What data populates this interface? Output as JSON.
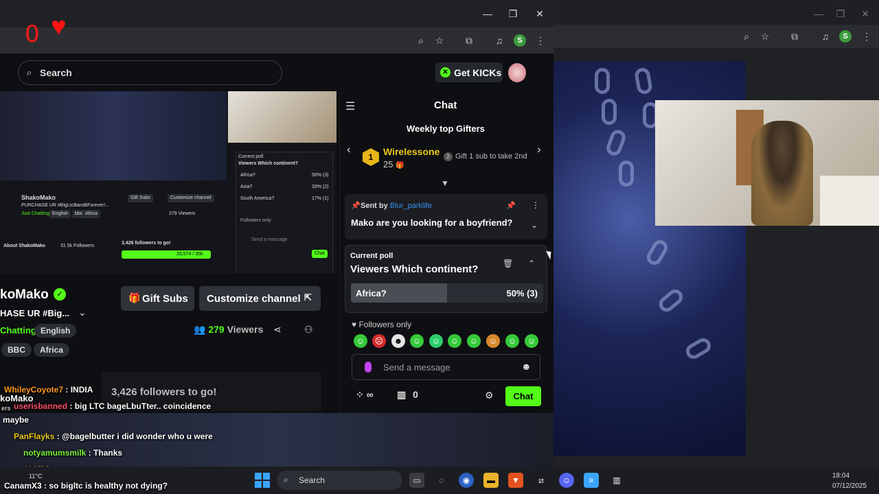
{
  "overlay_counter": "0",
  "browser": {
    "toolbar_icons": [
      "zoom-icon",
      "star-icon",
      "extension-icon",
      "media-icon",
      "profile-icon",
      "menu-icon"
    ],
    "profile_letter": "S"
  },
  "header": {
    "search_placeholder": "Search",
    "get_kicks": "Get KICKs"
  },
  "channel": {
    "name": "koMako",
    "title": "HASE UR #Big...",
    "category": "Chatting",
    "language": "English",
    "tags": [
      "BBC",
      "Africa"
    ],
    "gift_subs": "Gift Subs",
    "customize": "Customize channel",
    "viewer_count": "279",
    "viewers_label": "Viewers",
    "followers_goal": "3,426 followers to go!"
  },
  "mini_stream": {
    "channel": "ShakoMako",
    "purchase": "PURCHASE UR #BigLtcBanditForever!...",
    "category": "Just Chatting",
    "tags": [
      "English",
      "bbc",
      "Africa"
    ],
    "about": "About ShakoMako",
    "followers": "31.5k Followers",
    "viewers": "279 Viewers",
    "gift_subs": "Gift Subs",
    "customize": "Customize channel",
    "goal": "3,426 followers to go!",
    "goal_count": "33,574 / 35k",
    "poll_label": "Current poll",
    "poll_question": "Viewers Which continent?",
    "poll_options": [
      {
        "label": "Africa?",
        "value": "50% (3)"
      },
      {
        "label": "Asia?",
        "value": "33% (2)"
      },
      {
        "label": "South America?",
        "value": "17% (1)"
      }
    ],
    "followers_only": "Followers only",
    "send_placeholder": "Send a message",
    "chat": "Chat"
  },
  "chat": {
    "title": "Chat",
    "gifters_title": "Weekly top Gifters",
    "top_gifter": {
      "rank": "1",
      "name": "Wirelessone",
      "count": "25"
    },
    "gift_tip": "Gift 1 sub to take 2nd",
    "pinned": {
      "sent_by": "Sent by",
      "user": "Blur_parklife",
      "message": "Mako are you looking for a boyfriend?"
    },
    "poll": {
      "label": "Current poll",
      "question": "Viewers Which continent?",
      "option": "Africa?",
      "result": "50% (3)",
      "percent": 50
    },
    "followers_only": "Followers only",
    "placeholder": "Send a message",
    "infinity": "∞",
    "gift_count": "0",
    "send": "Chat"
  },
  "overlay_chat": [
    {
      "user": "WhileyCoyote7",
      "color": "#ff9a1f",
      "text": ": INDIA"
    },
    {
      "user": "userisbanned",
      "color": "#ff4f6a",
      "text": ": big LTC bageLbuTter.. coincidence"
    },
    {
      "user": "",
      "color": "#ffffff",
      "text": "maybe"
    },
    {
      "user": "PanFlayks",
      "color": "#e9c81a",
      "text": ": @bagelbutter i did wonder who u were"
    },
    {
      "user": "notyamumsmilk",
      "color": "#7ef33a",
      "text": ": Thanks"
    },
    {
      "user": "1337hiumx",
      "color": "#e9c81a",
      "text": ":"
    },
    {
      "user": "CanamX3",
      "color": "#ffffff",
      "text": ": so bigltc is healthy not dying?"
    }
  ],
  "overlay_fragments": {
    "name": "koMako",
    "ers": "ers"
  },
  "taskbar": {
    "search": "Search",
    "time": "18:04",
    "date": "07/12/2025",
    "weather": "11°C"
  },
  "colors": {
    "kick_green": "#53fc18",
    "gifter_gold": "#e7c71a",
    "link_blue": "#3a8ff2",
    "heart_red": "#ff1414"
  }
}
